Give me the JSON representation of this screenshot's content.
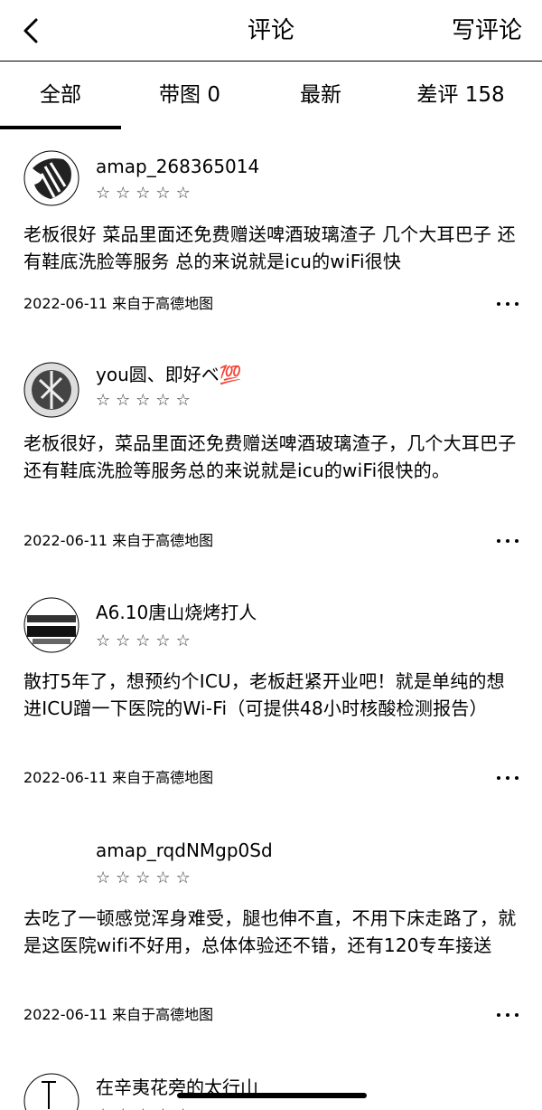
{
  "header": {
    "title": "评论",
    "write_label": "写评论"
  },
  "tabs": [
    {
      "label": "全部"
    },
    {
      "label": "带图 0"
    },
    {
      "label": "最新"
    },
    {
      "label": "差评 158"
    }
  ],
  "reviews": [
    {
      "username": "amap_268365014",
      "rating": 1,
      "text": "老板很好 菜品里面还免费赠送啤酒玻璃渣子 几个大耳巴子 还有鞋底洗脸等服务 总的来说就是icu的wiFi很快",
      "meta": "2022-06-11 来自于高德地图"
    },
    {
      "username": "you圆、即好ベ💯",
      "rating": 1,
      "text": "老板很好，菜品里面还免费赠送啤酒玻璃渣子，几个大耳巴子还有鞋底洗脸等服务总的来说就是icu的wiFi很快的。",
      "meta": "2022-06-11 来自于高德地图"
    },
    {
      "username": "A6.10唐山烧烤打人",
      "rating": 1,
      "text": "散打5年了，想预约个ICU，老板赶紧开业吧！就是单纯的想进ICU蹭一下医院的Wi-Fi（可提供48小时核酸检测报告）",
      "meta": "2022-06-11 来自于高德地图"
    },
    {
      "username": "amap_rqdNMgp0Sd",
      "rating": 1,
      "text": "去吃了一顿感觉浑身难受，腿也伸不直，不用下床走路了，就是这医院wifi不好用，总体体验还不错，还有120专车接送",
      "meta": "2022-06-11 来自于高德地图"
    },
    {
      "username": "在辛夷花旁的太行山",
      "rating": 1,
      "text": "",
      "meta": ""
    }
  ],
  "star_glyphs": {
    "filled": "★",
    "empty": "☆"
  }
}
